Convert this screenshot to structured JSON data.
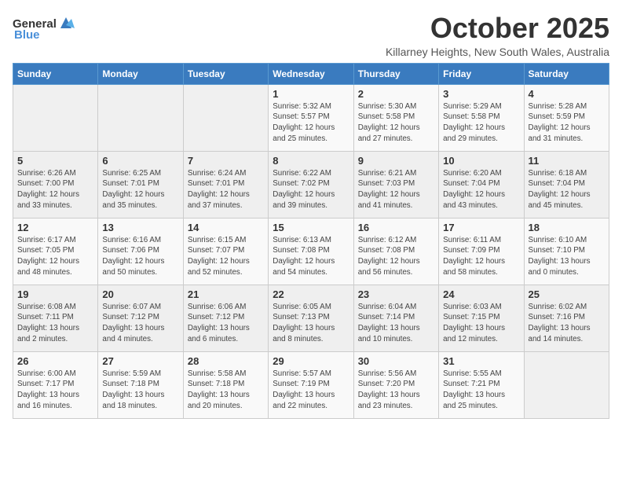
{
  "header": {
    "logo_general": "General",
    "logo_blue": "Blue",
    "month": "October 2025",
    "location": "Killarney Heights, New South Wales, Australia"
  },
  "weekdays": [
    "Sunday",
    "Monday",
    "Tuesday",
    "Wednesday",
    "Thursday",
    "Friday",
    "Saturday"
  ],
  "weeks": [
    [
      {
        "day": "",
        "info": ""
      },
      {
        "day": "",
        "info": ""
      },
      {
        "day": "",
        "info": ""
      },
      {
        "day": "1",
        "info": "Sunrise: 5:32 AM\nSunset: 5:57 PM\nDaylight: 12 hours\nand 25 minutes."
      },
      {
        "day": "2",
        "info": "Sunrise: 5:30 AM\nSunset: 5:58 PM\nDaylight: 12 hours\nand 27 minutes."
      },
      {
        "day": "3",
        "info": "Sunrise: 5:29 AM\nSunset: 5:58 PM\nDaylight: 12 hours\nand 29 minutes."
      },
      {
        "day": "4",
        "info": "Sunrise: 5:28 AM\nSunset: 5:59 PM\nDaylight: 12 hours\nand 31 minutes."
      }
    ],
    [
      {
        "day": "5",
        "info": "Sunrise: 6:26 AM\nSunset: 7:00 PM\nDaylight: 12 hours\nand 33 minutes."
      },
      {
        "day": "6",
        "info": "Sunrise: 6:25 AM\nSunset: 7:01 PM\nDaylight: 12 hours\nand 35 minutes."
      },
      {
        "day": "7",
        "info": "Sunrise: 6:24 AM\nSunset: 7:01 PM\nDaylight: 12 hours\nand 37 minutes."
      },
      {
        "day": "8",
        "info": "Sunrise: 6:22 AM\nSunset: 7:02 PM\nDaylight: 12 hours\nand 39 minutes."
      },
      {
        "day": "9",
        "info": "Sunrise: 6:21 AM\nSunset: 7:03 PM\nDaylight: 12 hours\nand 41 minutes."
      },
      {
        "day": "10",
        "info": "Sunrise: 6:20 AM\nSunset: 7:04 PM\nDaylight: 12 hours\nand 43 minutes."
      },
      {
        "day": "11",
        "info": "Sunrise: 6:18 AM\nSunset: 7:04 PM\nDaylight: 12 hours\nand 45 minutes."
      }
    ],
    [
      {
        "day": "12",
        "info": "Sunrise: 6:17 AM\nSunset: 7:05 PM\nDaylight: 12 hours\nand 48 minutes."
      },
      {
        "day": "13",
        "info": "Sunrise: 6:16 AM\nSunset: 7:06 PM\nDaylight: 12 hours\nand 50 minutes."
      },
      {
        "day": "14",
        "info": "Sunrise: 6:15 AM\nSunset: 7:07 PM\nDaylight: 12 hours\nand 52 minutes."
      },
      {
        "day": "15",
        "info": "Sunrise: 6:13 AM\nSunset: 7:08 PM\nDaylight: 12 hours\nand 54 minutes."
      },
      {
        "day": "16",
        "info": "Sunrise: 6:12 AM\nSunset: 7:08 PM\nDaylight: 12 hours\nand 56 minutes."
      },
      {
        "day": "17",
        "info": "Sunrise: 6:11 AM\nSunset: 7:09 PM\nDaylight: 12 hours\nand 58 minutes."
      },
      {
        "day": "18",
        "info": "Sunrise: 6:10 AM\nSunset: 7:10 PM\nDaylight: 13 hours\nand 0 minutes."
      }
    ],
    [
      {
        "day": "19",
        "info": "Sunrise: 6:08 AM\nSunset: 7:11 PM\nDaylight: 13 hours\nand 2 minutes."
      },
      {
        "day": "20",
        "info": "Sunrise: 6:07 AM\nSunset: 7:12 PM\nDaylight: 13 hours\nand 4 minutes."
      },
      {
        "day": "21",
        "info": "Sunrise: 6:06 AM\nSunset: 7:12 PM\nDaylight: 13 hours\nand 6 minutes."
      },
      {
        "day": "22",
        "info": "Sunrise: 6:05 AM\nSunset: 7:13 PM\nDaylight: 13 hours\nand 8 minutes."
      },
      {
        "day": "23",
        "info": "Sunrise: 6:04 AM\nSunset: 7:14 PM\nDaylight: 13 hours\nand 10 minutes."
      },
      {
        "day": "24",
        "info": "Sunrise: 6:03 AM\nSunset: 7:15 PM\nDaylight: 13 hours\nand 12 minutes."
      },
      {
        "day": "25",
        "info": "Sunrise: 6:02 AM\nSunset: 7:16 PM\nDaylight: 13 hours\nand 14 minutes."
      }
    ],
    [
      {
        "day": "26",
        "info": "Sunrise: 6:00 AM\nSunset: 7:17 PM\nDaylight: 13 hours\nand 16 minutes."
      },
      {
        "day": "27",
        "info": "Sunrise: 5:59 AM\nSunset: 7:18 PM\nDaylight: 13 hours\nand 18 minutes."
      },
      {
        "day": "28",
        "info": "Sunrise: 5:58 AM\nSunset: 7:18 PM\nDaylight: 13 hours\nand 20 minutes."
      },
      {
        "day": "29",
        "info": "Sunrise: 5:57 AM\nSunset: 7:19 PM\nDaylight: 13 hours\nand 22 minutes."
      },
      {
        "day": "30",
        "info": "Sunrise: 5:56 AM\nSunset: 7:20 PM\nDaylight: 13 hours\nand 23 minutes."
      },
      {
        "day": "31",
        "info": "Sunrise: 5:55 AM\nSunset: 7:21 PM\nDaylight: 13 hours\nand 25 minutes."
      },
      {
        "day": "",
        "info": ""
      }
    ]
  ]
}
